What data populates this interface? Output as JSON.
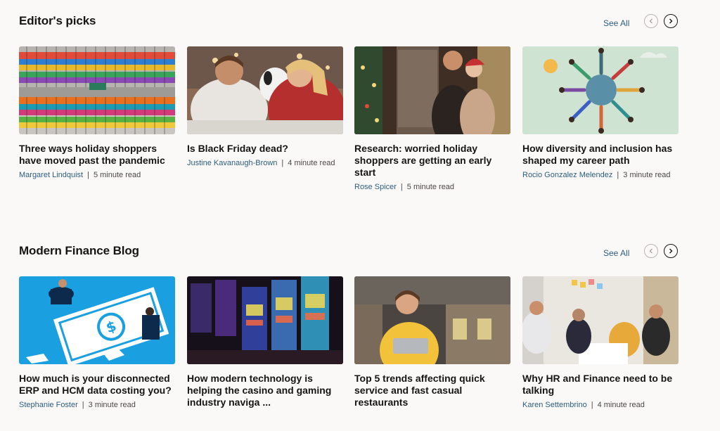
{
  "sections": [
    {
      "title": "Editor's picks",
      "see_all": "See All",
      "cards": [
        {
          "title": "Three ways holiday shoppers have moved past the pandemic",
          "author": "Margaret Lindquist",
          "read_time": "5 minute read"
        },
        {
          "title": "Is Black Friday dead?",
          "author": "Justine Kavanaugh-Brown",
          "read_time": "4 minute read"
        },
        {
          "title": "Research: worried holiday shoppers are getting an early start",
          "author": "Rose Spicer",
          "read_time": "5 minute read"
        },
        {
          "title": "How diversity and inclusion has shaped my career path",
          "author": "Rocio Gonzalez Melendez",
          "read_time": "3 minute read"
        }
      ]
    },
    {
      "title": "Modern Finance Blog",
      "see_all": "See All",
      "cards": [
        {
          "title": "How much is your disconnected ERP and HCM data costing you?",
          "author": "Stephanie Foster",
          "read_time": "3 minute read"
        },
        {
          "title": "How modern technology is helping the casino and gaming industry naviga ...",
          "author": "",
          "read_time": ""
        },
        {
          "title": "Top 5 trends affecting quick service and fast casual restaurants",
          "author": "",
          "read_time": ""
        },
        {
          "title": "Why HR and Finance need to be talking",
          "author": "Karen Settembrino",
          "read_time": "4 minute read"
        }
      ]
    }
  ],
  "separator": "|",
  "colors": {
    "link": "#2c5d80",
    "background": "#fbf9f8",
    "text": "#161513"
  },
  "icons": {
    "prev": "chevron-left-icon",
    "next": "chevron-right-icon"
  }
}
